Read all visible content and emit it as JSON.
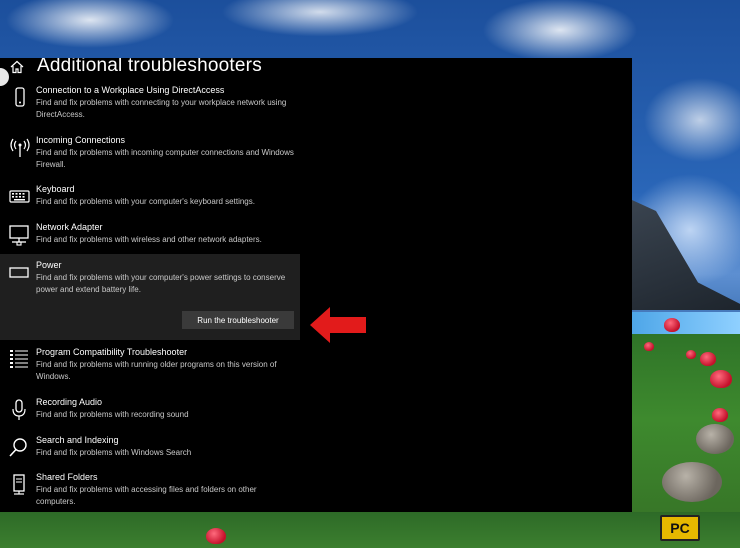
{
  "page": {
    "title": "Additional troubleshooters"
  },
  "items": [
    {
      "name": "Connection to a Workplace Using DirectAccess",
      "desc": "Find and fix problems with connecting to your workplace network using DirectAccess.",
      "icon": "phone-icon"
    },
    {
      "name": "Incoming Connections",
      "desc": "Find and fix problems with incoming computer connections and Windows Firewall.",
      "icon": "antenna-icon"
    },
    {
      "name": "Keyboard",
      "desc": "Find and fix problems with your computer's keyboard settings.",
      "icon": "keyboard-icon"
    },
    {
      "name": "Network Adapter",
      "desc": "Find and fix problems with wireless and other network adapters.",
      "icon": "monitor-network-icon"
    },
    {
      "name": "Power",
      "desc": "Find and fix problems with your computer's power settings to conserve power and extend battery life.",
      "icon": "battery-icon",
      "selected": true,
      "button_label": "Run the troubleshooter"
    },
    {
      "name": "Program Compatibility Troubleshooter",
      "desc": "Find and fix problems with running older programs on this version of Windows.",
      "icon": "list-icon"
    },
    {
      "name": "Recording Audio",
      "desc": "Find and fix problems with recording sound",
      "icon": "microphone-icon"
    },
    {
      "name": "Search and Indexing",
      "desc": "Find and fix problems with Windows Search",
      "icon": "search-icon"
    },
    {
      "name": "Shared Folders",
      "desc": "Find and fix problems with accessing files and folders on other computers.",
      "icon": "server-icon"
    }
  ],
  "logo": {
    "box_text": "PC"
  },
  "colors": {
    "panel_bg": "#000000",
    "selected_bg": "#1f1f1f",
    "button_bg": "#3a3a3a",
    "arrow": "#e21b1b"
  }
}
